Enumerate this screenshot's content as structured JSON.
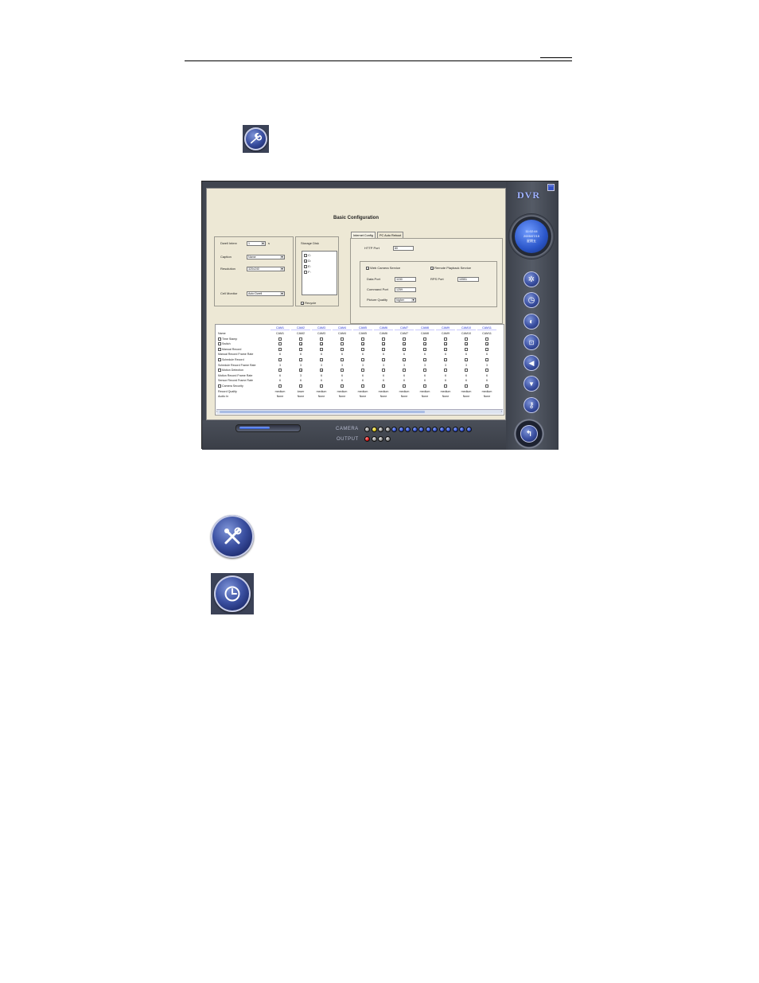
{
  "window": {
    "title": "Basic Configuration",
    "brand": "DVR",
    "minimize_glyph": "—"
  },
  "clock": {
    "time": "11:02:44",
    "date": "2005/07/15",
    "day": "星期五"
  },
  "left_panel": {
    "dwell_label": "Dwell Interv",
    "dwell_value": "1",
    "dwell_unit": "s",
    "caption_label": "Caption",
    "caption_value": "Name",
    "resolution_label": "Resolution",
    "resolution_value": "320x240",
    "cell_monitor_label": "Cell Monitor",
    "cell_monitor_value": "Auto Dwell"
  },
  "storage": {
    "label": "Storage Disk",
    "disks": [
      {
        "name": "C:",
        "checked": false
      },
      {
        "name": "D:",
        "checked": true
      },
      {
        "name": "E:",
        "checked": false
      },
      {
        "name": "F:",
        "checked": false
      }
    ],
    "recycle_label": "Recycle",
    "recycle_checked": true
  },
  "tabs": [
    {
      "label": "Internet Config",
      "active": true
    },
    {
      "label": "PC Auto Reboot",
      "active": false
    }
  ],
  "internet": {
    "http_port_label": "HTTP Port",
    "http_port_value": "80",
    "web_camera_label": "Web Camera Service",
    "remote_playback_label": "Remote Playback Service",
    "data_port_label": "Data Port",
    "data_port_value": "1150",
    "rps_port_label": "RPS Port",
    "rps_port_value": "10551",
    "command_port_label": "Command Port",
    "command_port_value": "1259",
    "picture_quality_label": "Picture Quality",
    "picture_quality_value": "higher"
  },
  "grid": {
    "headers": [
      "CAM1",
      "CAM2",
      "CAM3",
      "CAM4",
      "CAM5",
      "CAM6",
      "CAM7",
      "CAM8",
      "CAM9",
      "CAM10",
      "CAM11"
    ],
    "rows": [
      "Name",
      "Time Stamp",
      "Switch",
      "Manual Record",
      "Manual Record Frame Rate",
      "Schedule Record",
      "Schedule Record Frame Rate",
      "Motion Detection",
      "Motion Record Frame Rate",
      "Sensor Record Frame Rate",
      "Camera Security",
      "Record Quality",
      "Audio In"
    ],
    "row_checkbox": [
      false,
      true,
      true,
      true,
      false,
      true,
      false,
      true,
      false,
      false,
      true,
      false,
      false
    ],
    "names": [
      "CAM1",
      "CAM2",
      "CAM3",
      "CAM4",
      "CAM5",
      "CAM6",
      "CAM7",
      "CAM8",
      "CAM9",
      "CAM10",
      "CAM11"
    ],
    "switch_checked": [
      false,
      true,
      true,
      false,
      true,
      true,
      true,
      true,
      true,
      true,
      true
    ],
    "manual_rate": [
      "6",
      "6",
      "6",
      "6",
      "6",
      "6",
      "6",
      "6",
      "6",
      "6",
      "6"
    ],
    "schedule_rate": [
      "3",
      "3",
      "3",
      "3",
      "3",
      "3",
      "3",
      "3",
      "3",
      "3",
      "3"
    ],
    "motion_checked": [
      false,
      true,
      true,
      false,
      false,
      false,
      false,
      false,
      false,
      false,
      false
    ],
    "motion_rate": [
      "6",
      "3",
      "6",
      "6",
      "6",
      "6",
      "6",
      "6",
      "6",
      "6",
      "6"
    ],
    "sensor_rate": [
      "6",
      "6",
      "6",
      "6",
      "6",
      "6",
      "6",
      "6",
      "6",
      "6",
      "6"
    ],
    "quality": [
      "medium",
      "lower",
      "medium",
      "medium",
      "medium",
      "medium",
      "medium",
      "medium",
      "medium",
      "medium",
      "medium"
    ],
    "audio": [
      "None",
      "None",
      "None",
      "None",
      "None",
      "None",
      "None",
      "None",
      "None",
      "None",
      "None"
    ]
  },
  "bottom": {
    "camera_label": "CAMERA",
    "output_label": "OUTPUT"
  },
  "icons": {
    "top": "wrench-icon",
    "large_setup": "tools-icon",
    "large_clock": "clock-icon"
  }
}
